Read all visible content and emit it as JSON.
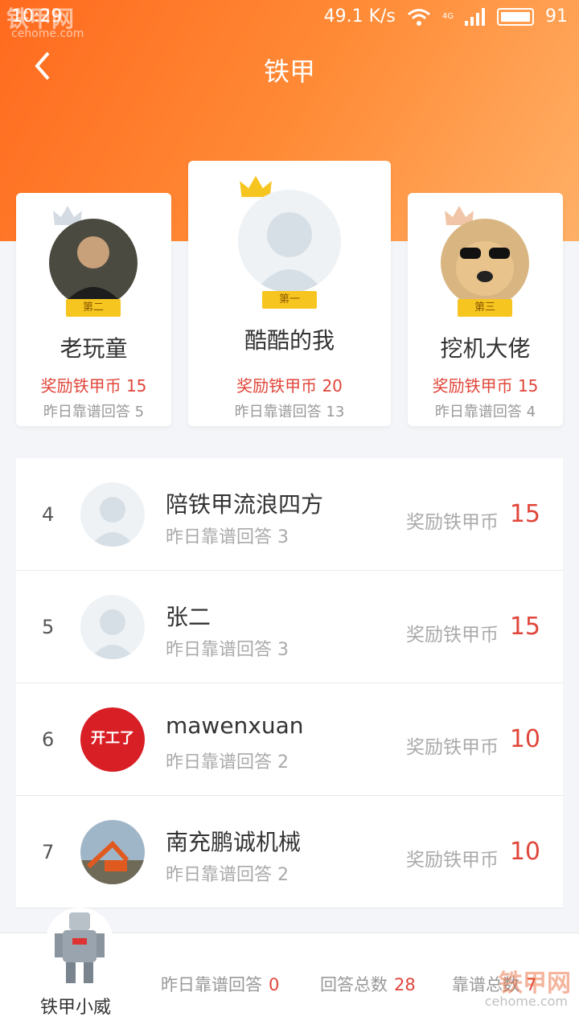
{
  "status": {
    "time": "10:29",
    "speed": "49.1 K/s",
    "network": "4G",
    "battery": "91",
    "watermark": "铁甲网",
    "watermark_sub": "cehome.com"
  },
  "header": {
    "title": "铁甲",
    "back_icon": "chevron-left-icon"
  },
  "top3": [
    {
      "rank_label": "第二",
      "name": "老玩童",
      "reward": "奖励铁甲币 15",
      "yesterday": "昨日靠谱回答 5"
    },
    {
      "rank_label": "第一",
      "name": "酷酷的我",
      "reward": "奖励铁甲币 20",
      "yesterday": "昨日靠谱回答 13"
    },
    {
      "rank_label": "第三",
      "name": "挖机大佬",
      "reward": "奖励铁甲币 15",
      "yesterday": "昨日靠谱回答 4"
    }
  ],
  "list": [
    {
      "num": "4",
      "name": "陪铁甲流浪四方",
      "yesterday": "昨日靠谱回答  3",
      "reward_label": "奖励铁甲币",
      "reward": "15"
    },
    {
      "num": "5",
      "name": "张二",
      "yesterday": "昨日靠谱回答  3",
      "reward_label": "奖励铁甲币",
      "reward": "15"
    },
    {
      "num": "6",
      "name": "mawenxuan",
      "yesterday": "昨日靠谱回答  2",
      "reward_label": "奖励铁甲币",
      "reward": "10"
    },
    {
      "num": "7",
      "name": "南充鹏诚机械",
      "yesterday": "昨日靠谱回答  2",
      "reward_label": "奖励铁甲币",
      "reward": "10"
    }
  ],
  "logo_text": "开工了",
  "footer": {
    "name": "铁甲小威",
    "yesterday_label": "昨日靠谱回答",
    "yesterday_value": "0",
    "total_label": "回答总数",
    "total_value": "28",
    "reliable_label": "靠谱总数",
    "reliable_value": "7"
  },
  "colors": {
    "accent": "#ff7a2b",
    "reward": "#e0463a",
    "gold": "#f7c520"
  }
}
